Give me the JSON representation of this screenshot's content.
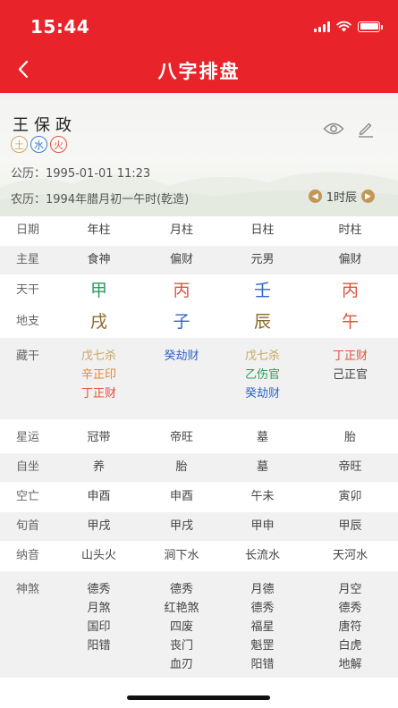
{
  "status_bar": {
    "time": "15:44"
  },
  "nav": {
    "title": "八字排盘",
    "back_icon": "chevron-left-icon"
  },
  "profile": {
    "name": "王保政",
    "elements": [
      "土",
      "水",
      "火"
    ],
    "solar_label": "公历：",
    "solar_date": "1995-01-01 11:23",
    "lunar_label": "农历：",
    "lunar_date": "1994年腊月初一午时(乾造)",
    "hour_label": "1时辰",
    "icons": {
      "view": "eye-icon",
      "edit": "pencil-icon",
      "prev": "chevron-left-circle-icon",
      "next": "chevron-right-circle-icon"
    }
  },
  "chart": {
    "headers": [
      "日期",
      "年柱",
      "月柱",
      "日柱",
      "时柱"
    ],
    "main_star": [
      "主星",
      "食神",
      "偏财",
      "元男",
      "偏财"
    ],
    "heavenly_stems": {
      "label": "天干",
      "values": [
        "甲",
        "丙",
        "壬",
        "丙"
      ],
      "colors": [
        "#2a9d5c",
        "#e0533a",
        "#2f66c9",
        "#e0533a"
      ]
    },
    "earthly_branches": {
      "label": "地支",
      "values": [
        "戌",
        "子",
        "辰",
        "午"
      ],
      "colors": [
        "#8a6a2e",
        "#2f66c9",
        "#8a6a2e",
        "#e0533a"
      ]
    },
    "hidden_stems": {
      "label": "藏干",
      "year": [
        "戊七杀",
        "辛正印",
        "丁正财"
      ],
      "month": [
        "癸劫财"
      ],
      "day": [
        "戊七杀",
        "乙伤官",
        "癸劫财"
      ],
      "hour": [
        "丁正财",
        "己正官"
      ]
    },
    "star_fortune": [
      "星运",
      "冠带",
      "帝旺",
      "墓",
      "胎"
    ],
    "self_seat": [
      "自坐",
      "养",
      "胎",
      "墓",
      "帝旺"
    ],
    "void": [
      "空亡",
      "申酉",
      "申酉",
      "午未",
      "寅卯"
    ],
    "xun_head": [
      "旬首",
      "甲戌",
      "甲戌",
      "甲申",
      "甲辰"
    ],
    "nayin": [
      "纳音",
      "山头火",
      "涧下水",
      "长流水",
      "天河水"
    ],
    "shensha": {
      "label": "神煞",
      "year": [
        "德秀",
        "月煞",
        "国印",
        "阳错"
      ],
      "month": [
        "德秀",
        "红艳煞",
        "四废",
        "丧门",
        "血刃"
      ],
      "day": [
        "月德",
        "德秀",
        "福星",
        "魁罡",
        "阳错"
      ],
      "hour": [
        "月空",
        "德秀",
        "唐符",
        "白虎",
        "地解"
      ]
    }
  }
}
